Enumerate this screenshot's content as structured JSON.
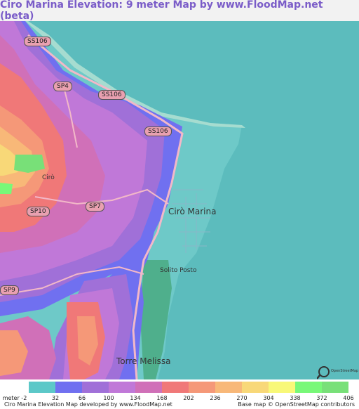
{
  "title": "Ciro Marina Elevation: 9 meter Map by www.FloodMap.net (beta)",
  "places": {
    "ciro_marina": "Cirò Marina",
    "ciro": "Cirò",
    "solito_posto": "Solito Posto",
    "torre_melissa": "Torre Melissa"
  },
  "roads": {
    "ss106_a": "SS106",
    "ss106_b": "SS106",
    "ss106_c": "SS106",
    "sp4": "SP4",
    "sp7": "SP7",
    "sp10": "SP10",
    "sp9": "SP9"
  },
  "legend": {
    "label": "meter -2",
    "ticks": [
      "32",
      "66",
      "100",
      "134",
      "168",
      "202",
      "236",
      "270",
      "304",
      "338",
      "372",
      "406"
    ],
    "colors": [
      "#5cc8c8",
      "#7070f0",
      "#a070d8",
      "#c078d8",
      "#d070b8",
      "#f07878",
      "#f59878",
      "#f8b878",
      "#f8d878",
      "#f8f878",
      "#78f878",
      "#78e078"
    ]
  },
  "footer": {
    "left": "Ciro Marina Elevation Map developed by www.FloodMap.net",
    "right": "Base map © OpenStreetMap contributors"
  },
  "osm_logo_text": "OpenStreetMap"
}
